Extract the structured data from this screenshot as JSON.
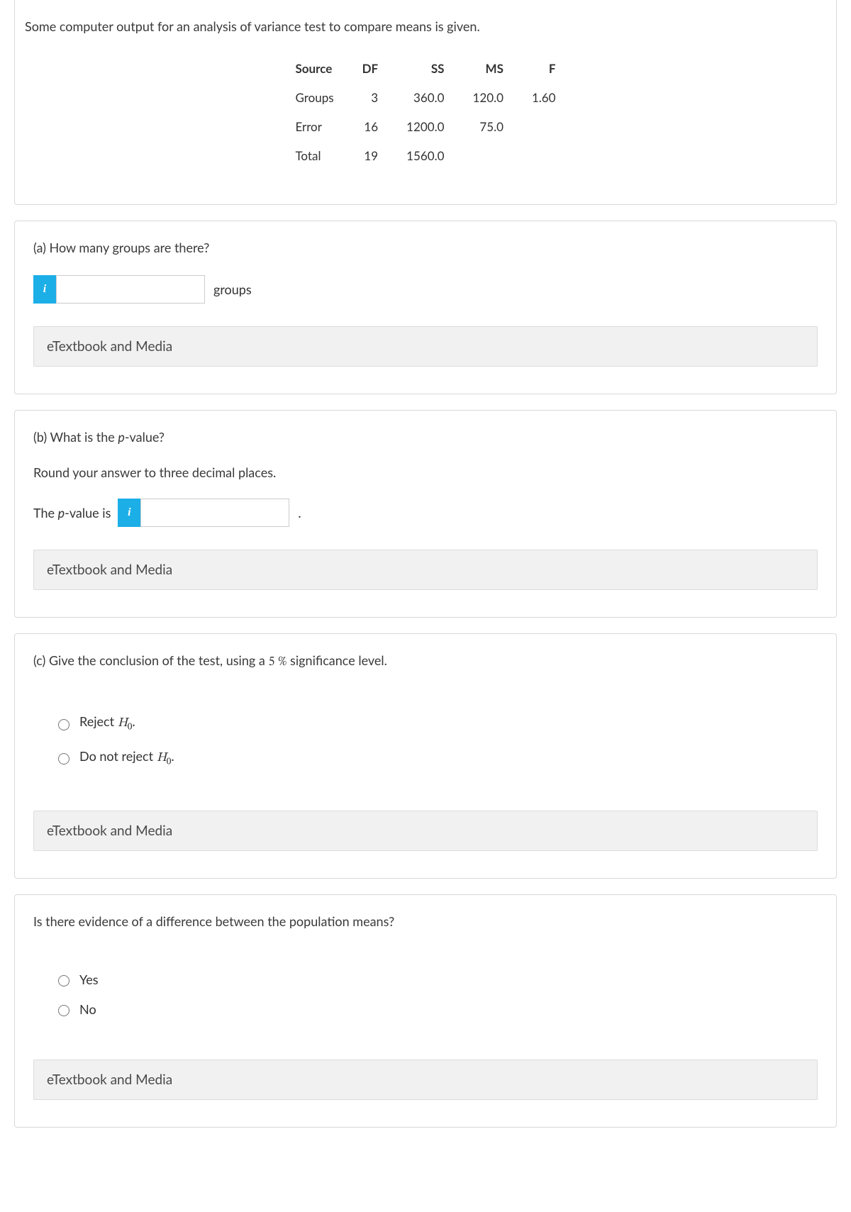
{
  "intro": "Some computer output for an analysis of variance test to compare means is given.",
  "anova": {
    "headers": [
      "Source",
      "DF",
      "SS",
      "MS",
      "F"
    ],
    "rows": [
      {
        "source": "Groups",
        "df": "3",
        "ss": "360.0",
        "ms": "120.0",
        "f": "1.60"
      },
      {
        "source": "Error",
        "df": "16",
        "ss": "1200.0",
        "ms": "75.0",
        "f": ""
      },
      {
        "source": "Total",
        "df": "19",
        "ss": "1560.0",
        "ms": "",
        "f": ""
      }
    ]
  },
  "partA": {
    "prompt": "(a) How many groups are there?",
    "unit": "groups"
  },
  "partB": {
    "prompt_before": "(b) What is the ",
    "prompt_pword": "p",
    "prompt_after": "-value?",
    "round": "Round your answer to three decimal places.",
    "lead_before": "The ",
    "lead_pword": "p",
    "lead_after": "-value is",
    "period": "."
  },
  "partC": {
    "prompt_before": "(c) Give the conclusion of the test, using a ",
    "siglevel": "5",
    "percent": "%",
    "prompt_after": "  significance level.",
    "opt1_before": "Reject ",
    "opt1_h": "H",
    "opt1_sub": "0",
    "opt1_after": ".",
    "opt2_before": "Do not reject ",
    "opt2_h": "H",
    "opt2_sub": "0",
    "opt2_after": "."
  },
  "partD": {
    "prompt": "Is there evidence of a difference between the population means?",
    "opt1": "Yes",
    "opt2": "No"
  },
  "resourceLabel": "eTextbook and Media"
}
